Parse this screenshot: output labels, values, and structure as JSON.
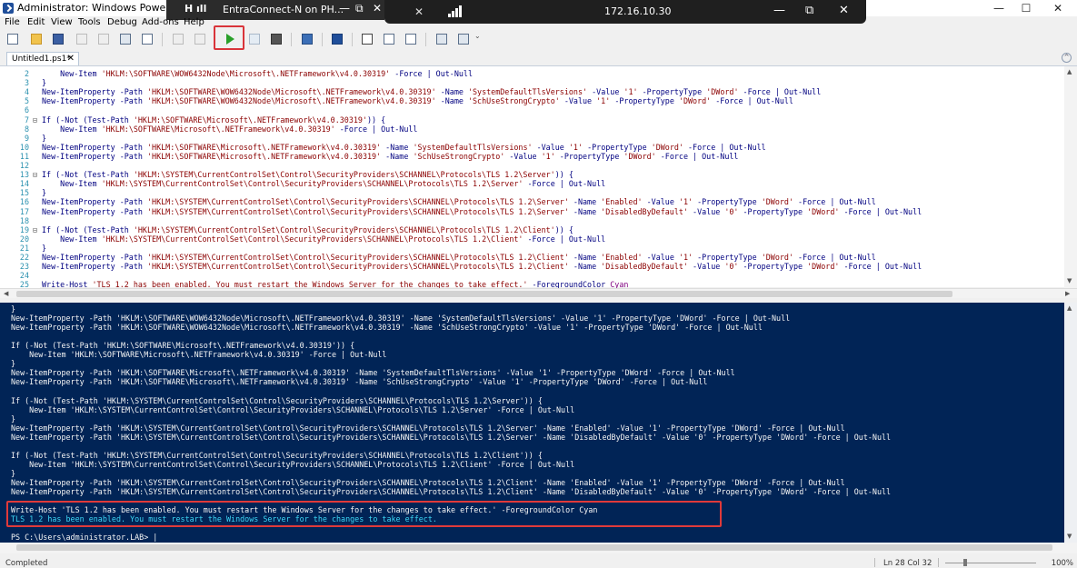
{
  "window": {
    "title": "Administrator: Windows PowerShell ISE",
    "minimize": "—",
    "maximize": "☐",
    "close": "✕"
  },
  "remote_bar": {
    "title": "EntraConnect-N on PH...",
    "ip": "172.16.10.30",
    "minimize": "—",
    "restore": "⧉",
    "close": "✕",
    "pin_icon": "pin-icon",
    "signal_icon": "signal-icon"
  },
  "menu": [
    "File",
    "Edit",
    "View",
    "Tools",
    "Debug",
    "Add-ons",
    "Help"
  ],
  "toolbar": {
    "run_icon": "run-script-icon",
    "run_highlight_color": "#d9343a"
  },
  "tab": {
    "label": "Untitled1.ps1*",
    "close": "✕"
  },
  "editor": {
    "lines": [
      {
        "n": "2",
        "fold": "",
        "text": "    New-Item 'HKLM:\\SOFTWARE\\WOW6432Node\\Microsoft\\.NETFramework\\v4.0.30319' -Force | Out-Null"
      },
      {
        "n": "3",
        "fold": "",
        "text": "}"
      },
      {
        "n": "4",
        "fold": "",
        "text": "New-ItemProperty -Path 'HKLM:\\SOFTWARE\\WOW6432Node\\Microsoft\\.NETFramework\\v4.0.30319' -Name 'SystemDefaultTlsVersions' -Value '1' -PropertyType 'DWord' -Force | Out-Null"
      },
      {
        "n": "5",
        "fold": "",
        "text": "New-ItemProperty -Path 'HKLM:\\SOFTWARE\\WOW6432Node\\Microsoft\\.NETFramework\\v4.0.30319' -Name 'SchUseStrongCrypto' -Value '1' -PropertyType 'DWord' -Force | Out-Null"
      },
      {
        "n": "6",
        "fold": "",
        "text": ""
      },
      {
        "n": "7",
        "fold": "⊟",
        "text": "If (-Not (Test-Path 'HKLM:\\SOFTWARE\\Microsoft\\.NETFramework\\v4.0.30319')) {"
      },
      {
        "n": "8",
        "fold": "",
        "text": "    New-Item 'HKLM:\\SOFTWARE\\Microsoft\\.NETFramework\\v4.0.30319' -Force | Out-Null"
      },
      {
        "n": "9",
        "fold": "",
        "text": "}"
      },
      {
        "n": "10",
        "fold": "",
        "text": "New-ItemProperty -Path 'HKLM:\\SOFTWARE\\Microsoft\\.NETFramework\\v4.0.30319' -Name 'SystemDefaultTlsVersions' -Value '1' -PropertyType 'DWord' -Force | Out-Null"
      },
      {
        "n": "11",
        "fold": "",
        "text": "New-ItemProperty -Path 'HKLM:\\SOFTWARE\\Microsoft\\.NETFramework\\v4.0.30319' -Name 'SchUseStrongCrypto' -Value '1' -PropertyType 'DWord' -Force | Out-Null"
      },
      {
        "n": "12",
        "fold": "",
        "text": ""
      },
      {
        "n": "13",
        "fold": "⊟",
        "text": "If (-Not (Test-Path 'HKLM:\\SYSTEM\\CurrentControlSet\\Control\\SecurityProviders\\SCHANNEL\\Protocols\\TLS 1.2\\Server')) {"
      },
      {
        "n": "14",
        "fold": "",
        "text": "    New-Item 'HKLM:\\SYSTEM\\CurrentControlSet\\Control\\SecurityProviders\\SCHANNEL\\Protocols\\TLS 1.2\\Server' -Force | Out-Null"
      },
      {
        "n": "15",
        "fold": "",
        "text": "}"
      },
      {
        "n": "16",
        "fold": "",
        "text": "New-ItemProperty -Path 'HKLM:\\SYSTEM\\CurrentControlSet\\Control\\SecurityProviders\\SCHANNEL\\Protocols\\TLS 1.2\\Server' -Name 'Enabled' -Value '1' -PropertyType 'DWord' -Force | Out-Null"
      },
      {
        "n": "17",
        "fold": "",
        "text": "New-ItemProperty -Path 'HKLM:\\SYSTEM\\CurrentControlSet\\Control\\SecurityProviders\\SCHANNEL\\Protocols\\TLS 1.2\\Server' -Name 'DisabledByDefault' -Value '0' -PropertyType 'DWord' -Force | Out-Null"
      },
      {
        "n": "18",
        "fold": "",
        "text": ""
      },
      {
        "n": "19",
        "fold": "⊟",
        "text": "If (-Not (Test-Path 'HKLM:\\SYSTEM\\CurrentControlSet\\Control\\SecurityProviders\\SCHANNEL\\Protocols\\TLS 1.2\\Client')) {"
      },
      {
        "n": "20",
        "fold": "",
        "text": "    New-Item 'HKLM:\\SYSTEM\\CurrentControlSet\\Control\\SecurityProviders\\SCHANNEL\\Protocols\\TLS 1.2\\Client' -Force | Out-Null"
      },
      {
        "n": "21",
        "fold": "",
        "text": "}"
      },
      {
        "n": "22",
        "fold": "",
        "text": "New-ItemProperty -Path 'HKLM:\\SYSTEM\\CurrentControlSet\\Control\\SecurityProviders\\SCHANNEL\\Protocols\\TLS 1.2\\Client' -Name 'Enabled' -Value '1' -PropertyType 'DWord' -Force | Out-Null"
      },
      {
        "n": "23",
        "fold": "",
        "text": "New-ItemProperty -Path 'HKLM:\\SYSTEM\\CurrentControlSet\\Control\\SecurityProviders\\SCHANNEL\\Protocols\\TLS 1.2\\Client' -Name 'DisabledByDefault' -Value '0' -PropertyType 'DWord' -Force | Out-Null"
      },
      {
        "n": "24",
        "fold": "",
        "text": ""
      },
      {
        "n": "25",
        "fold": "",
        "text": "Write-Host 'TLS 1.2 has been enabled. You must restart the Windows Server for the changes to take effect.' -ForegroundColor Cyan"
      }
    ]
  },
  "console": {
    "lines": [
      {
        "text": "}",
        "cyan": false
      },
      {
        "text": "New-ItemProperty -Path 'HKLM:\\SOFTWARE\\WOW6432Node\\Microsoft\\.NETFramework\\v4.0.30319' -Name 'SystemDefaultTlsVersions' -Value '1' -PropertyType 'DWord' -Force | Out-Null",
        "cyan": false
      },
      {
        "text": "New-ItemProperty -Path 'HKLM:\\SOFTWARE\\WOW6432Node\\Microsoft\\.NETFramework\\v4.0.30319' -Name 'SchUseStrongCrypto' -Value '1' -PropertyType 'DWord' -Force | Out-Null",
        "cyan": false
      },
      {
        "text": "",
        "cyan": false
      },
      {
        "text": "If (-Not (Test-Path 'HKLM:\\SOFTWARE\\Microsoft\\.NETFramework\\v4.0.30319')) {",
        "cyan": false
      },
      {
        "text": "    New-Item 'HKLM:\\SOFTWARE\\Microsoft\\.NETFramework\\v4.0.30319' -Force | Out-Null",
        "cyan": false
      },
      {
        "text": "}",
        "cyan": false
      },
      {
        "text": "New-ItemProperty -Path 'HKLM:\\SOFTWARE\\Microsoft\\.NETFramework\\v4.0.30319' -Name 'SystemDefaultTlsVersions' -Value '1' -PropertyType 'DWord' -Force | Out-Null",
        "cyan": false
      },
      {
        "text": "New-ItemProperty -Path 'HKLM:\\SOFTWARE\\Microsoft\\.NETFramework\\v4.0.30319' -Name 'SchUseStrongCrypto' -Value '1' -PropertyType 'DWord' -Force | Out-Null",
        "cyan": false
      },
      {
        "text": "",
        "cyan": false
      },
      {
        "text": "If (-Not (Test-Path 'HKLM:\\SYSTEM\\CurrentControlSet\\Control\\SecurityProviders\\SCHANNEL\\Protocols\\TLS 1.2\\Server')) {",
        "cyan": false
      },
      {
        "text": "    New-Item 'HKLM:\\SYSTEM\\CurrentControlSet\\Control\\SecurityProviders\\SCHANNEL\\Protocols\\TLS 1.2\\Server' -Force | Out-Null",
        "cyan": false
      },
      {
        "text": "}",
        "cyan": false
      },
      {
        "text": "New-ItemProperty -Path 'HKLM:\\SYSTEM\\CurrentControlSet\\Control\\SecurityProviders\\SCHANNEL\\Protocols\\TLS 1.2\\Server' -Name 'Enabled' -Value '1' -PropertyType 'DWord' -Force | Out-Null",
        "cyan": false
      },
      {
        "text": "New-ItemProperty -Path 'HKLM:\\SYSTEM\\CurrentControlSet\\Control\\SecurityProviders\\SCHANNEL\\Protocols\\TLS 1.2\\Server' -Name 'DisabledByDefault' -Value '0' -PropertyType 'DWord' -Force | Out-Null",
        "cyan": false
      },
      {
        "text": "",
        "cyan": false
      },
      {
        "text": "If (-Not (Test-Path 'HKLM:\\SYSTEM\\CurrentControlSet\\Control\\SecurityProviders\\SCHANNEL\\Protocols\\TLS 1.2\\Client')) {",
        "cyan": false
      },
      {
        "text": "    New-Item 'HKLM:\\SYSTEM\\CurrentControlSet\\Control\\SecurityProviders\\SCHANNEL\\Protocols\\TLS 1.2\\Client' -Force | Out-Null",
        "cyan": false
      },
      {
        "text": "}",
        "cyan": false
      },
      {
        "text": "New-ItemProperty -Path 'HKLM:\\SYSTEM\\CurrentControlSet\\Control\\SecurityProviders\\SCHANNEL\\Protocols\\TLS 1.2\\Client' -Name 'Enabled' -Value '1' -PropertyType 'DWord' -Force | Out-Null",
        "cyan": false
      },
      {
        "text": "New-ItemProperty -Path 'HKLM:\\SYSTEM\\CurrentControlSet\\Control\\SecurityProviders\\SCHANNEL\\Protocols\\TLS 1.2\\Client' -Name 'DisabledByDefault' -Value '0' -PropertyType 'DWord' -Force | Out-Null",
        "cyan": false
      },
      {
        "text": "",
        "cyan": false
      },
      {
        "text": "Write-Host 'TLS 1.2 has been enabled. You must restart the Windows Server for the changes to take effect.' -ForegroundColor Cyan",
        "cyan": false
      },
      {
        "text": "TLS 1.2 has been enabled. You must restart the Windows Server for the changes to take effect.",
        "cyan": true
      },
      {
        "text": "",
        "cyan": false
      },
      {
        "text": "PS C:\\Users\\administrator.LAB> |",
        "cyan": false
      }
    ],
    "background": "#012456",
    "output_color": "#3dd6f5",
    "highlight_color": "#e03a3a"
  },
  "status": {
    "state": "Completed",
    "position": "Ln 28  Col 32",
    "zoom": "100%"
  }
}
